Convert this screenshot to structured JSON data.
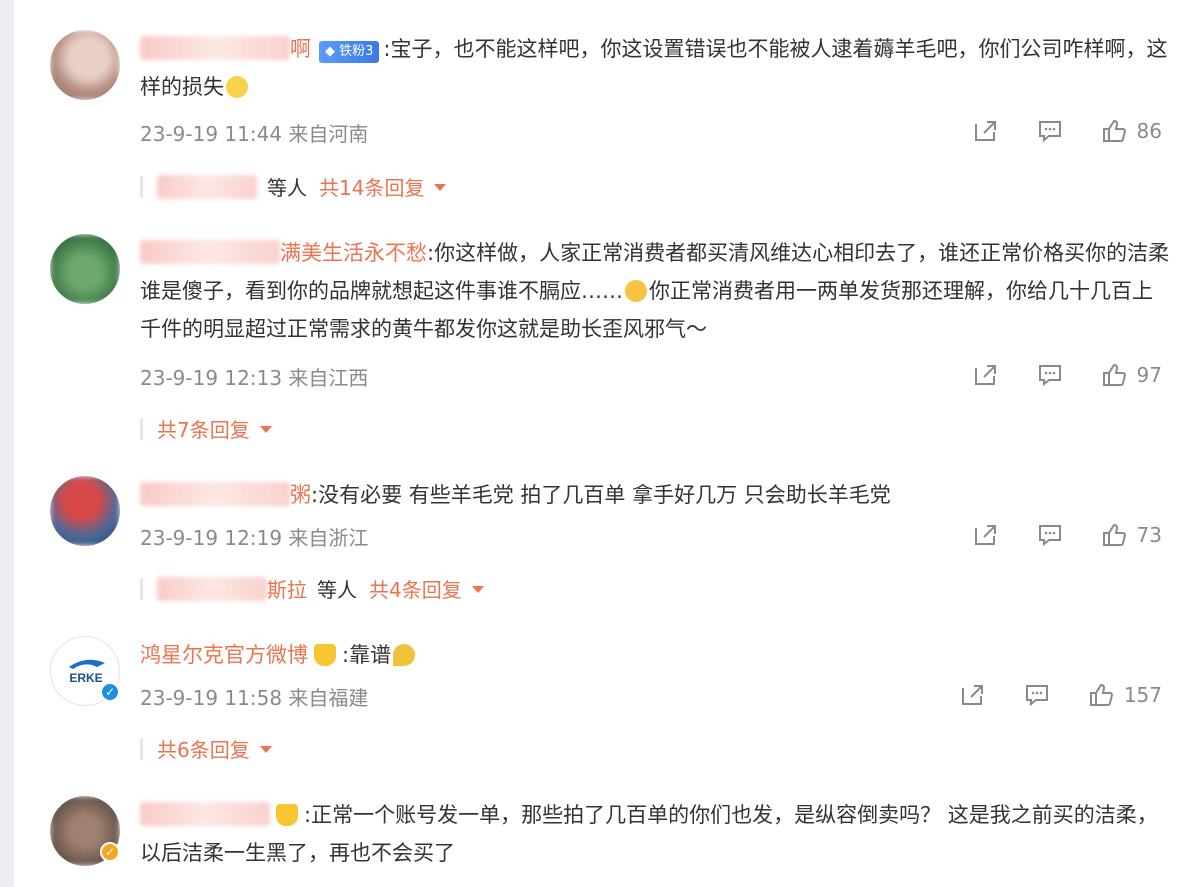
{
  "colors": {
    "accent": "#eb7350",
    "meta": "#8a8a8a",
    "text": "#333333"
  },
  "comments": [
    {
      "user_visible": "啊",
      "badge": "铁粉3",
      "text": ":宝子，也不能这样吧，你这设置错误也不能被人逮着薅羊毛吧，你们公司咋样啊，这样的损失",
      "emoji": "crying-face-emoji",
      "time": "23-9-19 11:44",
      "location": "来自河南",
      "likes": "86",
      "reply_etc": "等人",
      "reply_count": "共14条回复"
    },
    {
      "user_visible": "满美生活永不愁",
      "text1": ":你这样做，人家正常消费者都买清风维达心相印去了，谁还正常价格买你的洁柔谁是傻子，看到你的品牌就想起这件事谁不膈应……",
      "text2": "你正常消费者用一两单发货那还理解，你给几十几百上千件的明显超过正常需求的黄牛都发你这就是助长歪风邪气～",
      "emoji": "facepalm-emoji",
      "time": "23-9-19 12:13",
      "location": "来自江西",
      "likes": "97",
      "reply_count": "共7条回复"
    },
    {
      "user_visible": "粥",
      "text": ":没有必要 有些羊毛党 拍了几百单 拿手好几万 只会助长羊毛党",
      "time": "23-9-19 12:19",
      "location": "来自浙江",
      "likes": "73",
      "reply_names": "斯拉",
      "reply_etc": "等人",
      "reply_count": "共4条回复"
    },
    {
      "user": "鸿星尔克官方微博",
      "avatar_text": "ERKE",
      "text": ":靠谱",
      "emoji": "thumbs-up-emoji",
      "time": "23-9-19 11:58",
      "location": "来自福建",
      "likes": "157",
      "reply_count": "共6条回复"
    },
    {
      "text": ":正常一个账号发一单，那些拍了几百单的你们也发，是纵容倒卖吗？ 这是我之前买的洁柔，以后洁柔一生黑了，再也不会买了"
    }
  ]
}
